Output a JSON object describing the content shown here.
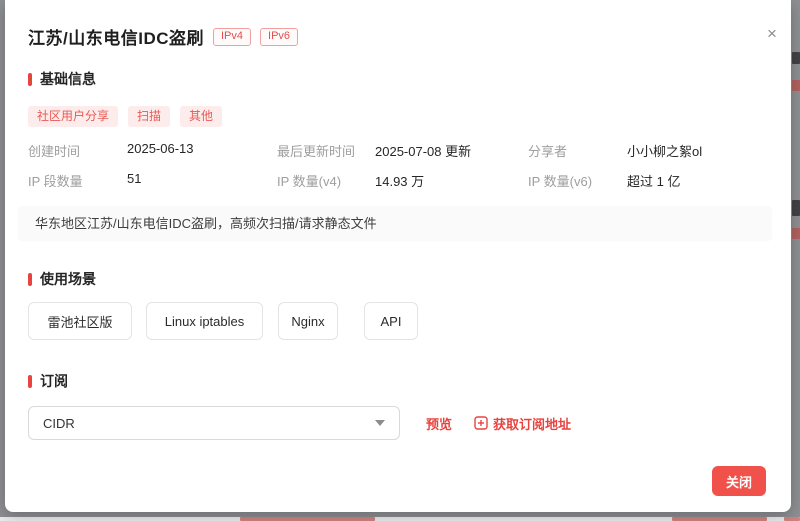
{
  "modal": {
    "title": "江苏/山东电信IDC盗刷",
    "close_icon": "×",
    "badges": [
      "IPv4",
      "IPv6"
    ],
    "basic": {
      "heading": "基础信息",
      "tags": [
        "社区用户分享",
        "扫描",
        "其他"
      ],
      "fields": [
        {
          "label": "创建时间",
          "value": "2025-06-13"
        },
        {
          "label": "最后更新时间",
          "value": "2025-07-08 更新"
        },
        {
          "label": "分享者",
          "value": "小小柳之絮ol"
        },
        {
          "label": "IP 段数量",
          "value": "51"
        },
        {
          "label": "IP 数量(v4)",
          "value": "14.93 万"
        },
        {
          "label": "IP 数量(v6)",
          "value": "超过 1 亿"
        }
      ],
      "description": "华东地区江苏/山东电信IDC盗刷，高频次扫描/请求静态文件"
    },
    "scenarios": {
      "heading": "使用场景",
      "buttons": [
        "雷池社区版",
        "Linux iptables",
        "Nginx",
        "API"
      ]
    },
    "subscribe": {
      "heading": "订阅",
      "format_selected": "CIDR",
      "preview_label": "预览",
      "get_url_label": "获取订阅地址"
    },
    "close_label": "关闭"
  },
  "colors": {
    "accent_red": "#e8443f",
    "close_button_red": "#f0514a",
    "tag_bg": "#fdecec",
    "tag_text": "#e85a54",
    "badge_border": "#f0a0a0"
  }
}
